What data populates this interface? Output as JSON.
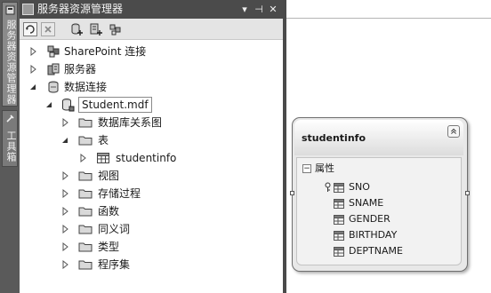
{
  "left_strip": {
    "tabs": [
      {
        "label": "服务器资源管理器",
        "icon": "server-explorer-icon"
      },
      {
        "label": "工具箱",
        "icon": "toolbox-icon"
      }
    ]
  },
  "panel": {
    "title": "服务器资源管理器",
    "controls": {
      "dropdown": "▾",
      "pin": "⊣",
      "close": "✕"
    },
    "toolbar_icons": [
      "refresh-icon",
      "stop-refresh-icon",
      "connect-database-icon",
      "connect-server-icon",
      "connect-sharepoint-icon"
    ],
    "tree": [
      {
        "label": "SharePoint 连接",
        "icon": "sharepoint-icon",
        "level": 0,
        "expanded": false
      },
      {
        "label": "服务器",
        "icon": "servers-icon",
        "level": 0,
        "expanded": false
      },
      {
        "label": "数据连接",
        "icon": "data-connections-icon",
        "level": 0,
        "expanded": true
      },
      {
        "label": "Student.mdf",
        "icon": "database-icon",
        "level": 1,
        "expanded": true,
        "selected": true
      },
      {
        "label": "数据库关系图",
        "icon": "folder-icon",
        "level": 2,
        "expanded": false
      },
      {
        "label": "表",
        "icon": "folder-icon",
        "level": 2,
        "expanded": true
      },
      {
        "label": "studentinfo",
        "icon": "table-icon",
        "level": 3,
        "expanded": false
      },
      {
        "label": "视图",
        "icon": "folder-icon",
        "level": 2,
        "expanded": false
      },
      {
        "label": "存储过程",
        "icon": "folder-icon",
        "level": 2,
        "expanded": false
      },
      {
        "label": "函数",
        "icon": "folder-icon",
        "level": 2,
        "expanded": false
      },
      {
        "label": "同义词",
        "icon": "folder-icon",
        "level": 2,
        "expanded": false
      },
      {
        "label": "类型",
        "icon": "folder-icon",
        "level": 2,
        "expanded": false
      },
      {
        "label": "程序集",
        "icon": "folder-icon",
        "level": 2,
        "expanded": false
      }
    ]
  },
  "designer": {
    "entity": {
      "title": "studentinfo",
      "collapse_glyph": "⌃",
      "section": {
        "toggle": "−",
        "label": "属性"
      },
      "fields": [
        {
          "name": "SNO",
          "key": true
        },
        {
          "name": "SNAME",
          "key": false
        },
        {
          "name": "GENDER",
          "key": false
        },
        {
          "name": "BIRTHDAY",
          "key": false
        },
        {
          "name": "DEPTNAME",
          "key": false
        }
      ]
    }
  }
}
